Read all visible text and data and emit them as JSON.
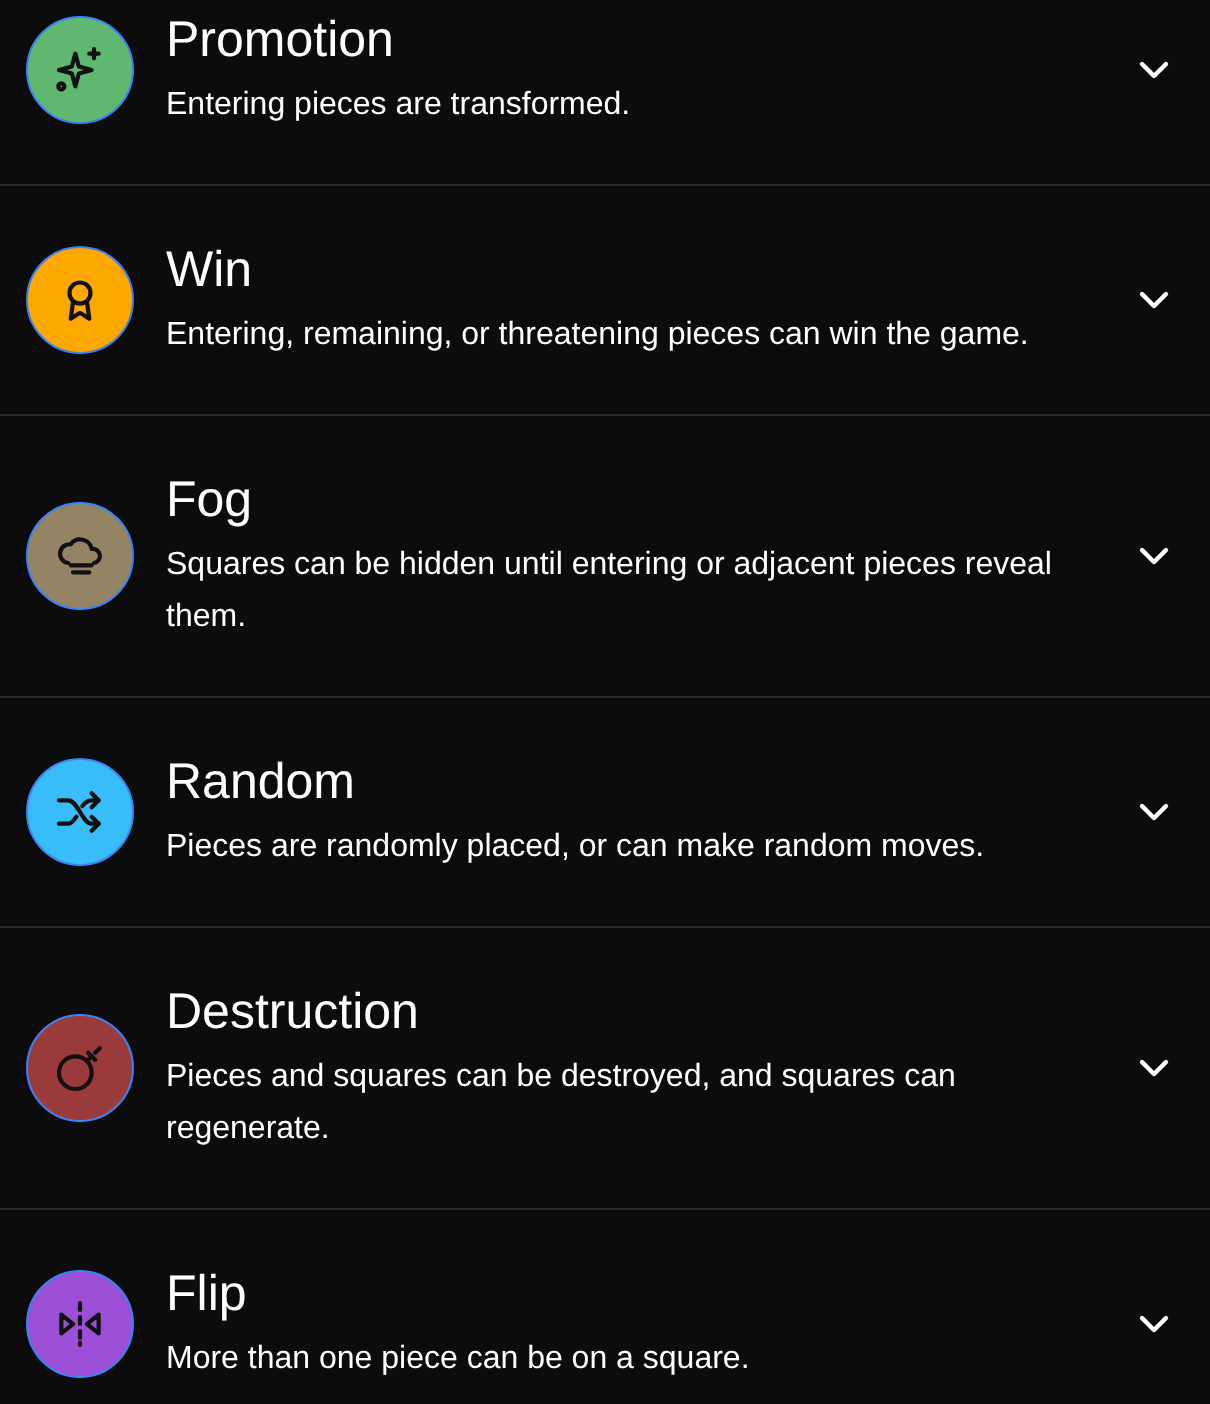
{
  "rules": [
    {
      "title": "Promotion",
      "description": "Entering pieces are transformed.",
      "color": "#5fb870",
      "expanded": false
    },
    {
      "title": "Win",
      "description": "Entering, remaining, or threatening pieces can win the game.",
      "color": "#fea800",
      "expanded": false
    },
    {
      "title": "Fog",
      "description": "Squares can be hidden until entering or adjacent pieces reveal them.",
      "color": "#948463",
      "expanded": false
    },
    {
      "title": "Random",
      "description": "Pieces are randomly placed, or can make random moves.",
      "color": "#38bdf8",
      "expanded": false
    },
    {
      "title": "Destruction",
      "description": "Pieces and squares can be destroyed, and squares can regenerate.",
      "color": "#9b3a3a",
      "expanded": false
    },
    {
      "title": "Flip",
      "description": "More than one piece can be on a square.",
      "color": "#9a4fd6",
      "expanded": false
    }
  ]
}
